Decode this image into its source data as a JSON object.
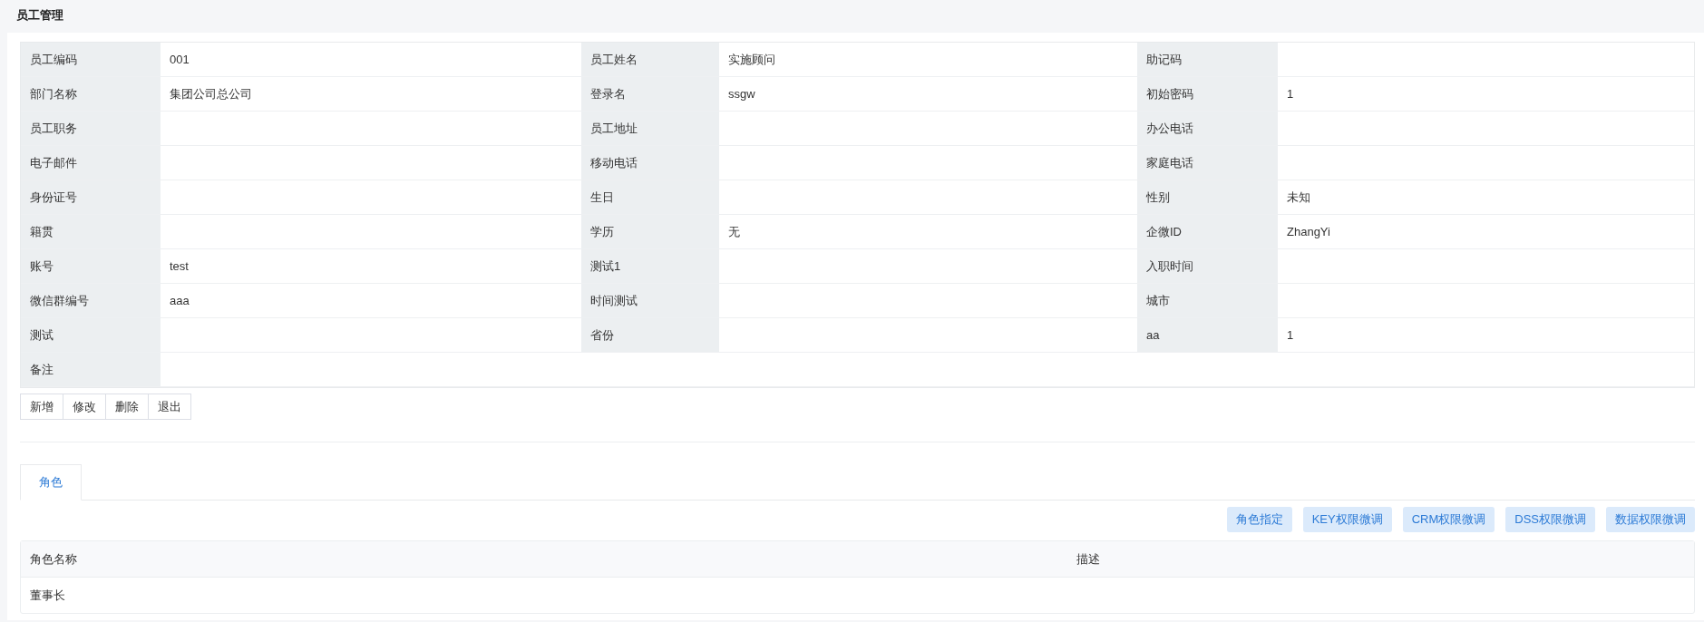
{
  "page_title": "员工管理",
  "form_rows": [
    [
      {
        "label": "员工编码",
        "value": "001"
      },
      {
        "label": "员工姓名",
        "value": "实施顾问"
      },
      {
        "label": "助记码"
      }
    ],
    [
      {
        "label": "部门名称",
        "value": "集团公司总公司"
      },
      {
        "label": "登录名",
        "value": "ssgw"
      },
      {
        "label": "初始密码",
        "value": "1"
      }
    ],
    [
      {
        "label": "员工职务"
      },
      {
        "label": "员工地址"
      },
      {
        "label": "办公电话"
      }
    ],
    [
      {
        "label": "电子邮件"
      },
      {
        "label": "移动电话"
      },
      {
        "label": "家庭电话"
      }
    ],
    [
      {
        "label": "身份证号"
      },
      {
        "label": "生日"
      },
      {
        "label": "性别",
        "value": "未知"
      }
    ],
    [
      {
        "label": "籍贯"
      },
      {
        "label": "学历",
        "value": "无"
      },
      {
        "label": "企微ID",
        "value": "ZhangYi"
      }
    ],
    [
      {
        "label": "账号",
        "value": "test"
      },
      {
        "label": "测试1"
      },
      {
        "label": "入职时间"
      }
    ],
    [
      {
        "label": "微信群编号",
        "value": "aaa"
      },
      {
        "label": "时间测试"
      },
      {
        "label": "城市"
      }
    ],
    [
      {
        "label": "测试"
      },
      {
        "label": "省份"
      },
      {
        "label": "aa",
        "value": "1"
      }
    ],
    [
      {
        "label": "备注"
      }
    ]
  ],
  "form_buttons": [
    "新增",
    "修改",
    "删除",
    "退出"
  ],
  "tabs": [
    {
      "label": "角色",
      "selected": true
    }
  ],
  "action_buttons": [
    "角色指定",
    "KEY权限微调",
    "CRM权限微调",
    "DSS权限微调",
    "数据权限微调"
  ],
  "table": {
    "columns": [
      "角色名称",
      "描述"
    ],
    "rows": [
      [
        "董事长"
      ]
    ]
  }
}
